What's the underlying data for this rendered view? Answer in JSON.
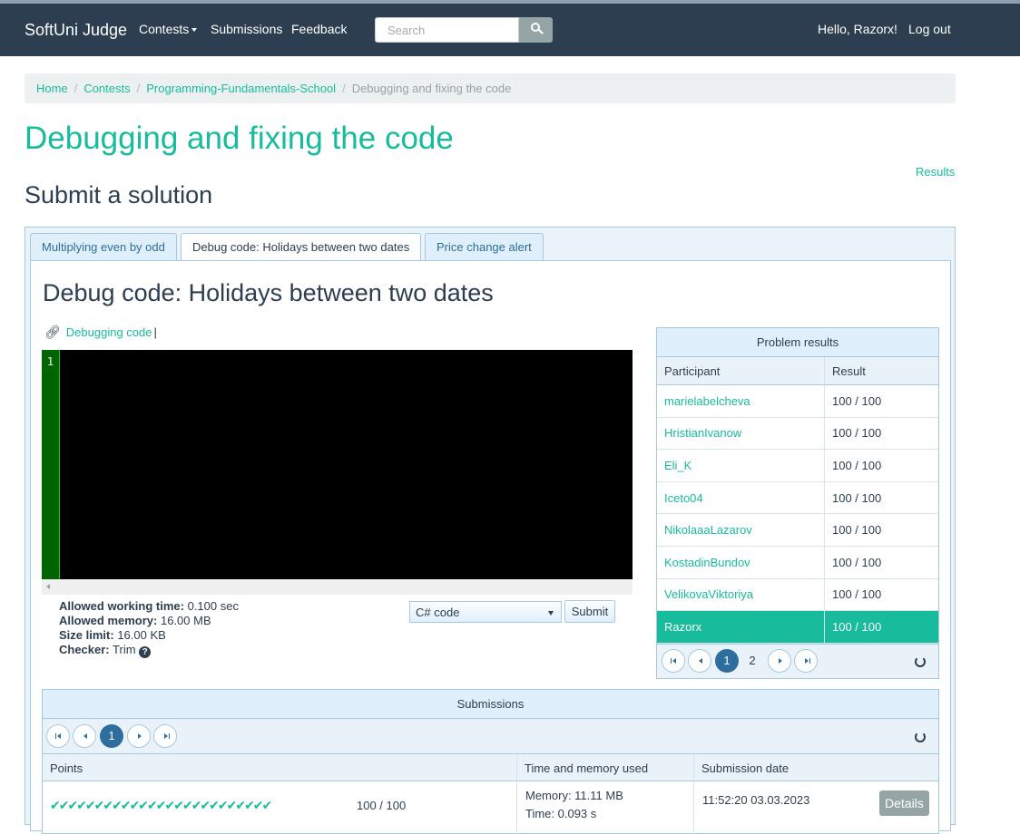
{
  "navbar": {
    "brand": "SoftUni Judge",
    "contests": "Contests",
    "submissions": "Submissions",
    "feedback": "Feedback",
    "search_placeholder": "Search",
    "greeting": "Hello, Razorx!",
    "logout": "Log out"
  },
  "breadcrumb": {
    "home": "Home",
    "contests": "Contests",
    "contest": "Programming-Fundamentals-School",
    "current": "Debugging and fixing the code"
  },
  "page": {
    "title": "Debugging and fixing the code",
    "results_link": "Results",
    "subtitle": "Submit a solution"
  },
  "tabs": [
    {
      "label": "Multiplying even by odd"
    },
    {
      "label": "Debug code: Holidays between two dates"
    },
    {
      "label": "Price change alert"
    }
  ],
  "problem": {
    "title": "Debug code: Holidays between two dates",
    "resource_link": "Debugging code",
    "editor_line": "1",
    "limits": {
      "time_label": "Allowed working time:",
      "time_value": "0.100 sec",
      "memory_label": "Allowed memory:",
      "memory_value": "16.00 MB",
      "size_label": "Size limit:",
      "size_value": "16.00 KB",
      "checker_label": "Checker:",
      "checker_value": "Trim"
    },
    "language": "C# code",
    "submit": "Submit"
  },
  "results": {
    "header": "Problem results",
    "col_participant": "Participant",
    "col_result": "Result",
    "rows": [
      {
        "name": "marielabelcheva",
        "score": "100 / 100"
      },
      {
        "name": "HristianIvanow",
        "score": "100 / 100"
      },
      {
        "name": "Eli_K",
        "score": "100 / 100"
      },
      {
        "name": "Iceto04",
        "score": "100 / 100"
      },
      {
        "name": "NikolaaaLazarov",
        "score": "100 / 100"
      },
      {
        "name": "KostadinBundov",
        "score": "100 / 100"
      },
      {
        "name": "VelikovaViktoriya",
        "score": "100 / 100"
      },
      {
        "name": "Razorx",
        "score": "100 / 100"
      }
    ],
    "pages": [
      "1",
      "2"
    ]
  },
  "submissions": {
    "header": "Submissions",
    "page": "1",
    "col_points": "Points",
    "col_time": "Time and memory used",
    "col_date": "Submission date",
    "row": {
      "checks": "✔✔✔✔✔✔✔✔✔✔✔✔✔✔✔✔✔✔✔✔✔✔✔✔✔",
      "points": "100 / 100",
      "memory": "Memory: 11.11 MB",
      "time": "Time: 0.093 s",
      "date": "11:52:20 03.03.2023",
      "details": "Details"
    }
  }
}
